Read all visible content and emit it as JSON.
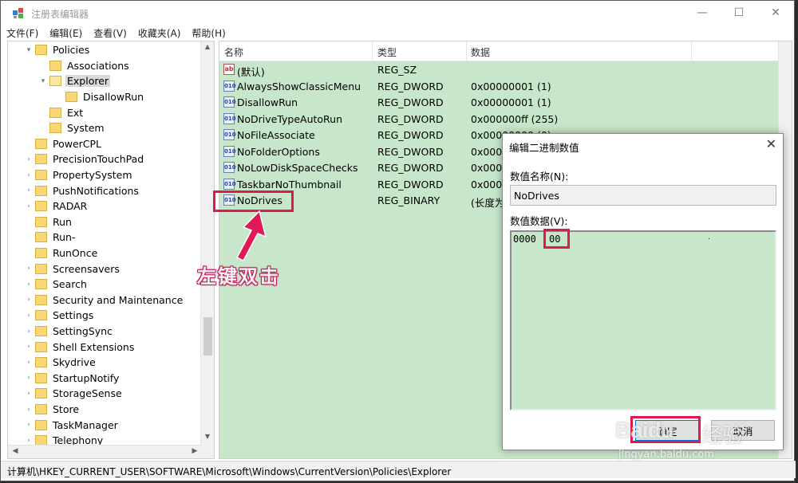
{
  "window": {
    "title": "注册表编辑器",
    "min": "—",
    "max": "☐",
    "close": "✕"
  },
  "menu": [
    "文件(F)",
    "编辑(E)",
    "查看(V)",
    "收藏夹(A)",
    "帮助(H)"
  ],
  "tree": [
    {
      "label": "Policies",
      "arrow": "▾",
      "indent": 0
    },
    {
      "label": "Associations",
      "arrow": "",
      "indent": 1
    },
    {
      "label": "Explorer",
      "arrow": "▾",
      "indent": 1,
      "selected": true
    },
    {
      "label": "DisallowRun",
      "arrow": "",
      "indent": 2
    },
    {
      "label": "Ext",
      "arrow": "",
      "indent": 1
    },
    {
      "label": "System",
      "arrow": "",
      "indent": 1
    },
    {
      "label": "PowerCPL",
      "arrow": "",
      "indent": 0
    },
    {
      "label": "PrecisionTouchPad",
      "arrow": "›",
      "indent": 0
    },
    {
      "label": "PropertySystem",
      "arrow": "›",
      "indent": 0
    },
    {
      "label": "PushNotifications",
      "arrow": "›",
      "indent": 0
    },
    {
      "label": "RADAR",
      "arrow": "›",
      "indent": 0
    },
    {
      "label": "Run",
      "arrow": "",
      "indent": 0
    },
    {
      "label": "Run-",
      "arrow": "",
      "indent": 0
    },
    {
      "label": "RunOnce",
      "arrow": "",
      "indent": 0
    },
    {
      "label": "Screensavers",
      "arrow": "›",
      "indent": 0
    },
    {
      "label": "Search",
      "arrow": "›",
      "indent": 0
    },
    {
      "label": "Security and Maintenance",
      "arrow": "›",
      "indent": 0
    },
    {
      "label": "Settings",
      "arrow": "›",
      "indent": 0
    },
    {
      "label": "SettingSync",
      "arrow": "›",
      "indent": 0
    },
    {
      "label": "Shell Extensions",
      "arrow": "›",
      "indent": 0
    },
    {
      "label": "Skydrive",
      "arrow": "›",
      "indent": 0
    },
    {
      "label": "StartupNotify",
      "arrow": "›",
      "indent": 0
    },
    {
      "label": "StorageSense",
      "arrow": "›",
      "indent": 0
    },
    {
      "label": "Store",
      "arrow": "›",
      "indent": 0
    },
    {
      "label": "TaskManager",
      "arrow": "›",
      "indent": 0
    },
    {
      "label": "Telephony",
      "arrow": "›",
      "indent": 0
    }
  ],
  "list": {
    "headers": {
      "name": "名称",
      "type": "类型",
      "data": "数据"
    },
    "rows": [
      {
        "name": "(默认)",
        "type": "REG_SZ",
        "data": "",
        "icon": "ab"
      },
      {
        "name": "AlwaysShowClassicMenu",
        "type": "REG_DWORD",
        "data": "0x00000001 (1)",
        "icon": "010"
      },
      {
        "name": "DisallowRun",
        "type": "REG_DWORD",
        "data": "0x00000001 (1)",
        "icon": "010"
      },
      {
        "name": "NoDriveTypeAutoRun",
        "type": "REG_DWORD",
        "data": "0x000000ff (255)",
        "icon": "010"
      },
      {
        "name": "NoFileAssociate",
        "type": "REG_DWORD",
        "data": "0x00000000 (0)",
        "icon": "010"
      },
      {
        "name": "NoFolderOptions",
        "type": "REG_DWORD",
        "data": "0x0000",
        "icon": "010"
      },
      {
        "name": "NoLowDiskSpaceChecks",
        "type": "REG_DWORD",
        "data": "0x0000",
        "icon": "010"
      },
      {
        "name": "TaskbarNoThumbnail",
        "type": "REG_DWORD",
        "data": "0x0000",
        "icon": "010"
      },
      {
        "name": "NoDrives",
        "type": "REG_BINARY",
        "data": "(长度为",
        "icon": "010"
      }
    ]
  },
  "annotation": "左键双击",
  "dialog": {
    "title": "编辑二进制数值",
    "close": "✕",
    "name_label": "数值名称(N):",
    "name_value": "NoDrives",
    "data_label": "数值数据(V):",
    "hex_offset": "0000",
    "hex_byte": "00",
    "hex_ascii": ".",
    "ok": "确定",
    "cancel": "取消"
  },
  "status": "计算机\\HKEY_CURRENT_USER\\SOFTWARE\\Microsoft\\Windows\\CurrentVersion\\Policies\\Explorer",
  "watermark": {
    "logo": "Baidu",
    "cn": "经验",
    "url": "jingyan.baidu.com"
  },
  "colors": {
    "list_bg": "#c8e6c9",
    "highlight": "#e0194d",
    "folder": "#f8d775"
  }
}
